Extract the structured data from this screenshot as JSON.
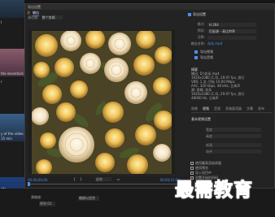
{
  "dialog": {
    "title": "导出设置",
    "tabs": [
      {
        "label": "源"
      },
      {
        "label": "输出"
      }
    ],
    "source_range_label": "源范围:",
    "source_range_value": "整个剪辑"
  },
  "left_panel": {
    "items": [
      {
        "label": "I"
      },
      {
        "label": "the essentials"
      },
      {
        "label": "r"
      },
      {
        "label": "y of the video"
      },
      {
        "label": "15 min"
      },
      {
        "label": "nts"
      },
      {
        "label": "by adjusting"
      },
      {
        "label": "ing system"
      }
    ]
  },
  "playback": {
    "timecode_in": "00;00;00;00",
    "timecode_out": "00;00;15;00",
    "fit_label": "适合",
    "progress_fraction": 0.0
  },
  "settings": {
    "header": "导出设置",
    "rows": [
      {
        "key": "格式:",
        "value": "H.264"
      },
      {
        "key": "预设:",
        "value": "匹配源 - 高比特率"
      },
      {
        "key": "注释:",
        "value": ""
      },
      {
        "key": "输出名称:",
        "value": "花朵.mp4"
      }
    ],
    "export_video": "导出视频",
    "export_audio": "导出音频",
    "summary_title": "摘要",
    "summary_lines": [
      "输出: D:\\花朵.mp4",
      "1920x1080 (1.0), 29.97 fps, 逐行",
      "VBR, 1 次, 目标 10.00 Mbps",
      "AAC, 320 kbps, 48 kHz, 立体声",
      "源: 剪辑, 花朵",
      "1920x1080 (1.0), 29.97 fps, 逐行",
      "48000 Hz, 立体声"
    ],
    "tabs": [
      {
        "label": "效果"
      },
      {
        "label": "视频"
      },
      {
        "label": "音频"
      },
      {
        "label": "多路复用器"
      },
      {
        "label": "字幕"
      },
      {
        "label": "发布"
      }
    ],
    "section_title": "基本视频设置",
    "fields": [
      {
        "label": "宽度"
      },
      {
        "label": "高度"
      },
      {
        "label": "帧速率"
      },
      {
        "label": "场序"
      }
    ],
    "bottom_checks": [
      {
        "label": "使用最高渲染质量"
      },
      {
        "label": "使用预览"
      },
      {
        "label": "导入项目中"
      },
      {
        "label": "设置开始时间码"
      }
    ]
  },
  "bottom_bar": {
    "source_scaling_label": "源缩放:",
    "source_scaling_value": "缩放以适合",
    "sequence_label": "序列 01"
  },
  "watermark": {
    "text": "最需教育"
  }
}
